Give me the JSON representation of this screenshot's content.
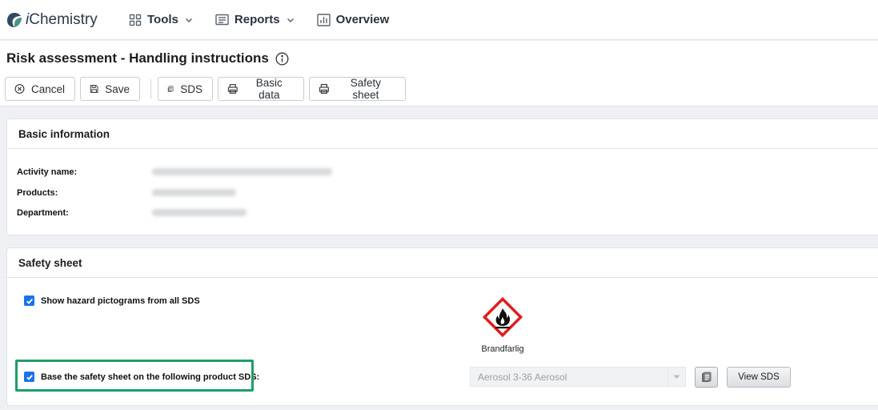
{
  "app": {
    "brand_prefix": "i",
    "brand_rest": "Chemistry"
  },
  "nav": {
    "tools": "Tools",
    "reports": "Reports",
    "overview": "Overview"
  },
  "page": {
    "title": "Risk assessment - Handling instructions"
  },
  "toolbar": {
    "cancel": "Cancel",
    "save": "Save",
    "sds": "SDS",
    "basic_data": "Basic data",
    "safety_sheet": "Safety sheet"
  },
  "basic_info": {
    "heading": "Basic information",
    "activity_label": "Activity name:",
    "products_label": "Products:",
    "department_label": "Department:"
  },
  "safety_sheet": {
    "heading": "Safety sheet",
    "show_pictograms_label": "Show hazard pictograms from all SDS",
    "show_pictograms_checked": true,
    "base_on_product_label": "Base the safety sheet on the following product SDS:",
    "base_on_product_checked": true,
    "pictogram_icon": "flammable-icon",
    "pictogram_label": "Brandfarlig",
    "product_select_value": "Aerosol 3-36 Aerosol",
    "view_sds": "View SDS"
  },
  "colors": {
    "accent": "#1a73e8",
    "highlight": "#1f9d6b",
    "hazard_red": "#e11d1d"
  }
}
